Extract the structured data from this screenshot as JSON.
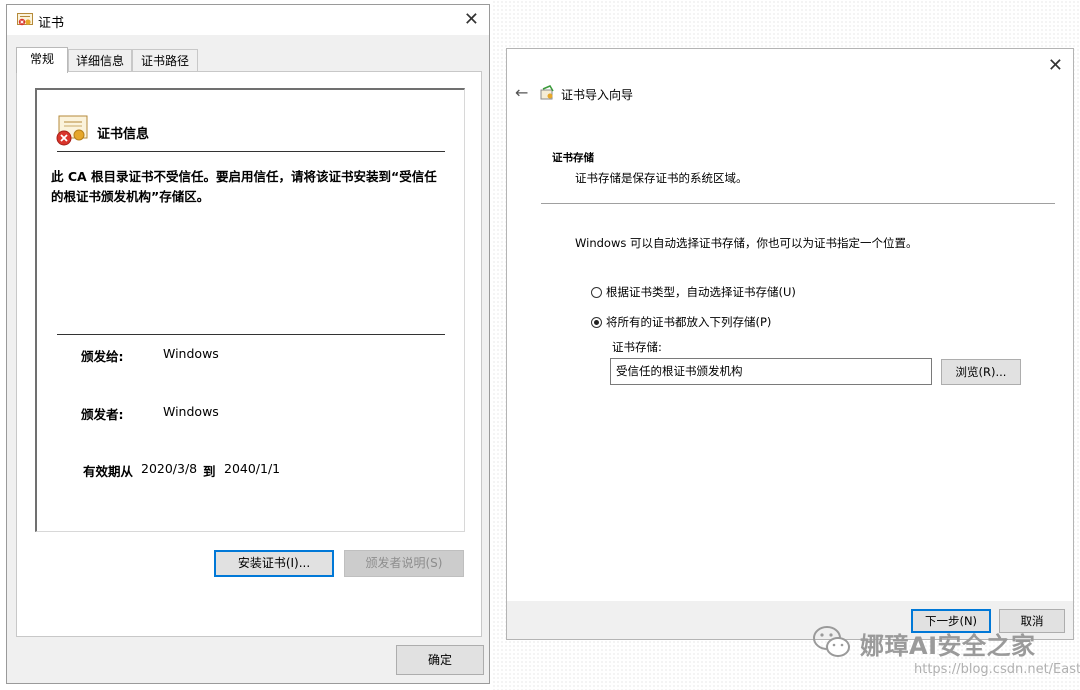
{
  "cert_window": {
    "title": "证书",
    "tabs": [
      "常规",
      "详细信息",
      "证书路径"
    ],
    "info_title": "证书信息",
    "warning": "此 CA 根目录证书不受信任。要启用信任，请将该证书安装到“受信任的根证书颁发机构”存储区。",
    "issued_to_label": "颁发给:",
    "issued_to_value": "Windows",
    "issued_by_label": "颁发者:",
    "issued_by_value": "Windows",
    "validity_label": "有效期从",
    "valid_from": "2020/3/8",
    "to_label": "到",
    "valid_to": "2040/1/1",
    "install_button": "安装证书(I)...",
    "issuer_statement_button": "颁发者说明(S)",
    "ok_button": "确定"
  },
  "wizard": {
    "title": "证书导入向导",
    "section_heading": "证书存储",
    "section_desc": "证书存储是保存证书的系统区域。",
    "intro": "Windows 可以自动选择证书存储，你也可以为证书指定一个位置。",
    "radio_auto": "根据证书类型，自动选择证书存储(U)",
    "radio_manual": "将所有的证书都放入下列存储(P)",
    "store_label": "证书存储:",
    "store_value": "受信任的根证书颁发机构",
    "browse_button": "浏览(R)...",
    "next_button": "下一步(N)",
    "cancel_button": "取消"
  },
  "watermark": {
    "text": "娜璋AI安全之家",
    "url": "https://blog.csdn.net/Eastmount"
  }
}
